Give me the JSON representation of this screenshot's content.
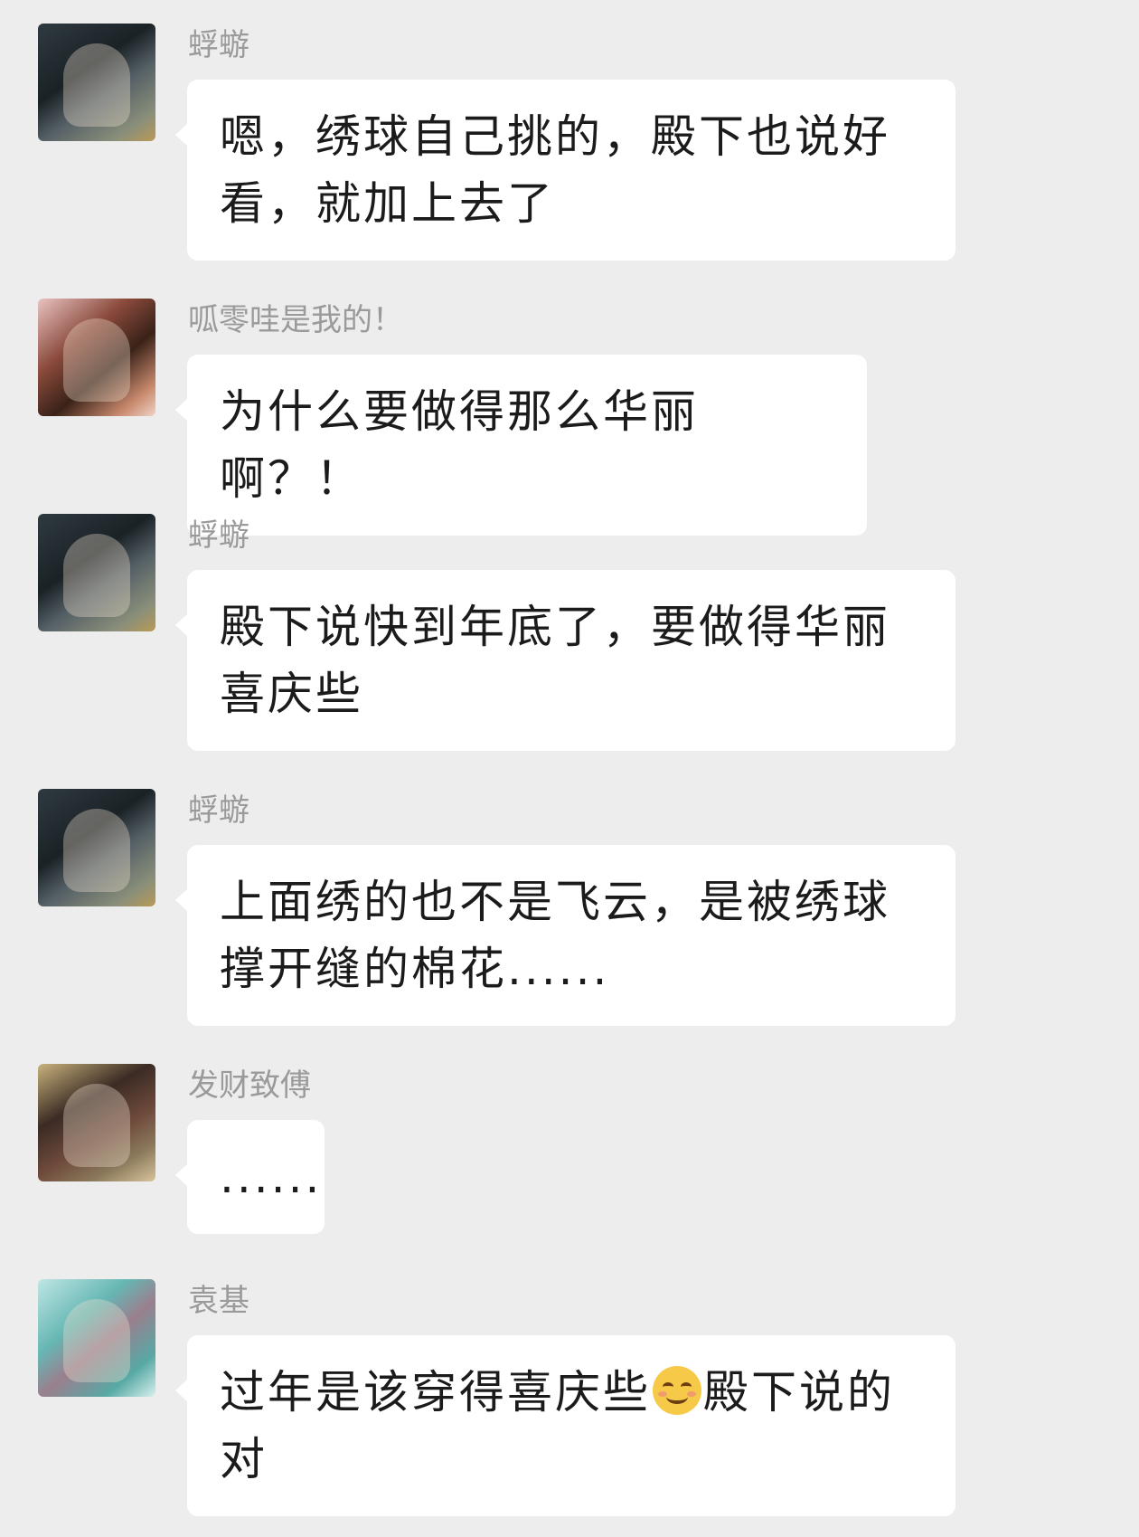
{
  "messages": [
    {
      "sender": "蜉蝣",
      "avatar_icon": "avatar-dark-hair-portrait",
      "text": "嗯，绣球自己挑的，殿下也说好看，就加上去了"
    },
    {
      "sender": "呱零哇是我的！",
      "avatar_icon": "avatar-sleeping-portrait",
      "text": "为什么要做得那么华丽啊？！"
    },
    {
      "sender": "蜉蝣",
      "avatar_icon": "avatar-dark-hair-portrait",
      "text": "殿下说快到年底了，要做得华丽喜庆些"
    },
    {
      "sender": "蜉蝣",
      "avatar_icon": "avatar-dark-hair-portrait",
      "text": "上面绣的也不是飞云，是被绣球撑开缝的棉花......"
    },
    {
      "sender": "发财致傅",
      "avatar_icon": "avatar-two-figures-portrait",
      "text": "......"
    },
    {
      "sender": "袁基",
      "avatar_icon": "avatar-teal-portrait",
      "text_before_emoji": "过年是该穿得喜庆些",
      "emoji_icon": "smiling-face-emoji",
      "text_after_emoji": "殿下说的对"
    }
  ]
}
